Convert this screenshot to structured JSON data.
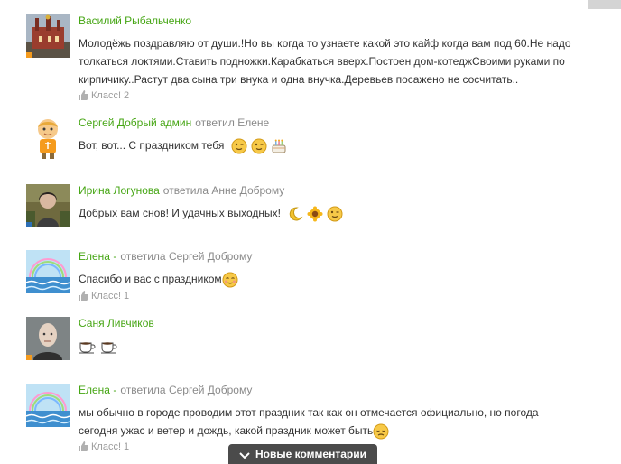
{
  "comments": [
    {
      "author": "Василий Рыбальченко",
      "reply_to": "",
      "text": "Молодёжь поздравляю от души.!Но вы  когда то узнаете какой это кайф когда вам под 60.Не надо толкаться локтями.Ставить подножки.Карабкаться вверх.Постоен дом-котеджСвоими руками по кирпичику..Растут два сына  три внука и одна внучка.Деревьев посажено не сосчитать..",
      "emojis": [],
      "likes": "Класс! 2",
      "online_color": "#f59b1d"
    },
    {
      "author": "Сергей Добрый админ",
      "reply_to": "ответил Елене",
      "text": "Вот, вот... С праздником тебя",
      "emojis": [
        "wink-emoji",
        "wink-emoji",
        "cake-emoji"
      ],
      "likes": "",
      "online_color": ""
    },
    {
      "author": "Ирина Логунова",
      "reply_to": "ответила Анне Доброму",
      "text": "Добрых вам снов! И удачных выходных!",
      "emojis": [
        "moon-emoji",
        "sunflower-emoji",
        "wink-emoji"
      ],
      "likes": "",
      "online_color": "#2d6fb6"
    },
    {
      "author": "Елена -",
      "reply_to": "ответила Сергей Доброму",
      "text": "Спасибо и вас с праздником",
      "emojis": [
        "blush-emoji"
      ],
      "likes": "Класс! 1",
      "online_color": ""
    },
    {
      "author": "Саня Ливчиков",
      "reply_to": "",
      "text": "",
      "emojis": [
        "coffee-cup-emoji",
        "coffee-cup-emoji"
      ],
      "likes": "",
      "online_color": "#f59b1d"
    },
    {
      "author": "Елена -",
      "reply_to": "ответила Сергей Доброму",
      "text": "мы обычно в городе проводим этот праздник так как он отмечается официально, но погода сегодня ужас и ветер и дождь, какой праздник может быть",
      "emojis": [
        "sad-emoji"
      ],
      "likes": "Класс! 1",
      "online_color": ""
    }
  ],
  "new_comments_label": "Новые комментарии",
  "colors": {
    "author_name": "#46a614",
    "reply_text": "#8a8a8a",
    "new_comments_bar": "#4b4b4b"
  }
}
